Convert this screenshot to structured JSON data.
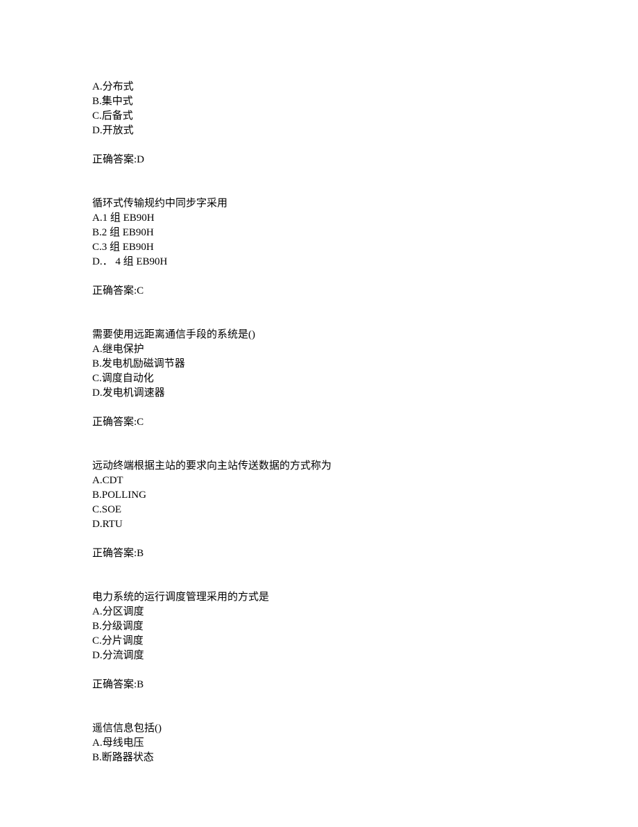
{
  "questions": [
    {
      "stem": "",
      "options": [
        "A.分布式",
        "B.集中式",
        "C.后备式",
        "D.开放式"
      ],
      "answer": "正确答案:D"
    },
    {
      "stem": "循环式传输规约中同步字采用",
      "options": [
        "A.1 组 EB90H",
        "B.2 组 EB90H",
        "C.3 组 EB90H",
        "D.． 4 组 EB90H"
      ],
      "answer": "正确答案:C"
    },
    {
      "stem": "需要使用远距离通信手段的系统是()",
      "options": [
        "A.继电保护",
        "B.发电机励磁调节器",
        "C.调度自动化",
        "D.发电机调速器"
      ],
      "answer": "正确答案:C"
    },
    {
      "stem": "远动终端根据主站的要求向主站传送数据的方式称为",
      "options": [
        "A.CDT",
        "B.POLLING",
        "C.SOE",
        "D.RTU"
      ],
      "answer": "正确答案:B"
    },
    {
      "stem": "电力系统的运行调度管理采用的方式是",
      "options": [
        "A.分区调度",
        "B.分级调度",
        "C.分片调度",
        "D.分流调度"
      ],
      "answer": "正确答案:B"
    },
    {
      "stem": "遥信信息包括()",
      "options": [
        "A.母线电压",
        "B.断路器状态"
      ],
      "answer": ""
    }
  ]
}
